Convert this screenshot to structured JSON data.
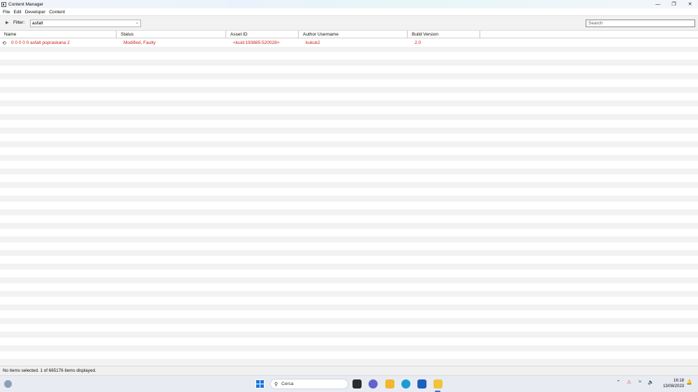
{
  "window": {
    "title": "Content Manager",
    "controls": {
      "minimize": "—",
      "maximize": "❐",
      "close": "✕"
    }
  },
  "menu": [
    "File",
    "Edit",
    "Developer",
    "Content"
  ],
  "filterbar": {
    "toggle_icon": "▶",
    "label": "Filter:",
    "filter_value": "asfalt",
    "search_placeholder": "Search"
  },
  "table": {
    "columns": [
      "Name",
      "Status",
      "Asset ID",
      "Author Username",
      "Build Version"
    ],
    "rows": [
      {
        "icon": "⟲",
        "name": "0 0 0 0 0 asfalt popraskana 2",
        "status": "Modified, Faulty",
        "asset_id": "<kuid:193885:520028>",
        "author": "kukuk2",
        "build": "2.0"
      }
    ],
    "row_color": "#cc2222"
  },
  "status_bar": "No items selected. 1 of 665176 items displayed.",
  "taskbar": {
    "search_label": "Cerca",
    "time": "16:18",
    "date": "13/08/2023"
  }
}
